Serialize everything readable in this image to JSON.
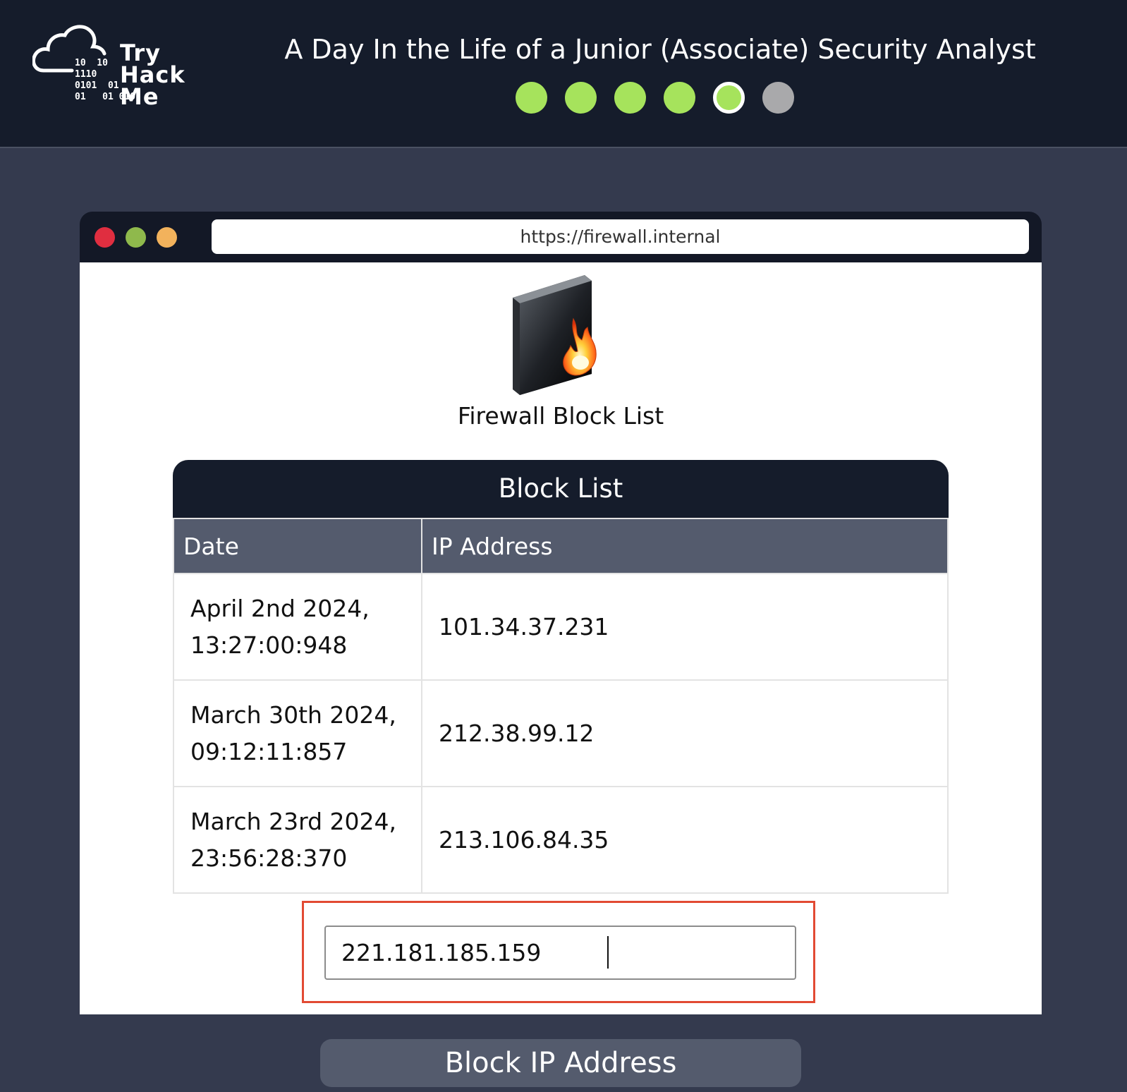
{
  "header": {
    "logo_text": [
      "Try",
      "Hack",
      "Me"
    ],
    "logo_binary": "10  10\n1110\n0101  01\n01   01 010",
    "title": "A Day In the Life of a Junior (Associate) Security Analyst",
    "progress": {
      "total": 6,
      "completed": 4,
      "current": 5,
      "colors": {
        "done": "#a6e35c",
        "todo": "#a9a9ab"
      }
    }
  },
  "browser": {
    "url": "https://firewall.internal",
    "window_controls": [
      "close",
      "minimize",
      "maximize"
    ]
  },
  "page": {
    "icon": "firewall-icon",
    "title": "Firewall Block List",
    "card_title": "Block List",
    "columns": [
      "Date",
      "IP Address"
    ],
    "rows": [
      {
        "date_line1": "April 2nd 2024,",
        "date_line2": "13:27:00:948",
        "ip": "101.34.37.231"
      },
      {
        "date_line1": "March 30th 2024,",
        "date_line2": "09:12:11:857",
        "ip": "212.38.99.12"
      },
      {
        "date_line1": "March 23rd 2024,",
        "date_line2": "23:56:28:370",
        "ip": "213.106.84.35"
      }
    ],
    "ip_input_value": "221.181.185.159",
    "highlight_color": "#e24a33"
  },
  "actions": {
    "block_button": "Block IP Address"
  }
}
